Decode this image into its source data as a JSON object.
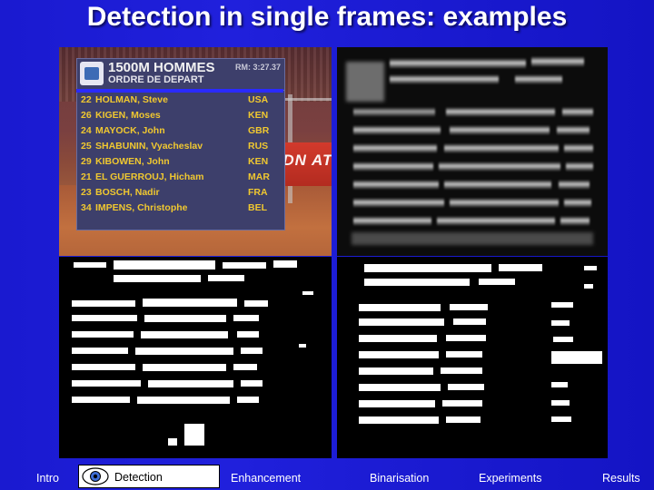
{
  "slide": {
    "title": "Detection in single frames: examples",
    "background_color": "#1a1acc",
    "title_color": "#ffffff"
  },
  "images": {
    "top_left": {
      "name": "original-colour-frame",
      "scoreboard": {
        "header_line1": "1500M HOMMES",
        "header_line2": "ORDRE DE DEPART",
        "timer": "RM: 3:27.37",
        "rows": [
          {
            "num": "22",
            "name": "HOLMAN, Steve",
            "country": "USA"
          },
          {
            "num": "26",
            "name": "KIGEN, Moses",
            "country": "KEN"
          },
          {
            "num": "24",
            "name": "MAYOCK, John",
            "country": "GBR"
          },
          {
            "num": "25",
            "name": "SHABUNIN, Vyacheslav",
            "country": "RUS"
          },
          {
            "num": "29",
            "name": "KIBOWEN, John",
            "country": "KEN"
          },
          {
            "num": "21",
            "name": "EL GUERROUJ, Hicham",
            "country": "MAR"
          },
          {
            "num": "23",
            "name": "BOSCH, Nadir",
            "country": "FRA"
          },
          {
            "num": "34",
            "name": "IMPENS, Christophe",
            "country": "BEL"
          }
        ]
      },
      "banner_text": "DN ATHLON"
    },
    "top_right": {
      "name": "enhanced-greyscale-frame"
    },
    "bottom_left": {
      "name": "binarised-frame-left"
    },
    "bottom_right": {
      "name": "binarised-frame-right"
    }
  },
  "nav": {
    "items": [
      {
        "label": "Intro",
        "active": false
      },
      {
        "label": "Detection",
        "active": true
      },
      {
        "label": "Enhancement",
        "active": false
      },
      {
        "label": "Binarisation",
        "active": false
      },
      {
        "label": "Experiments",
        "active": false
      },
      {
        "label": "Results",
        "active": false
      }
    ],
    "active_icon": "eye-icon",
    "active_bg": "#ffffff",
    "active_text_color": "#000000",
    "text_color": "#ffffff"
  }
}
